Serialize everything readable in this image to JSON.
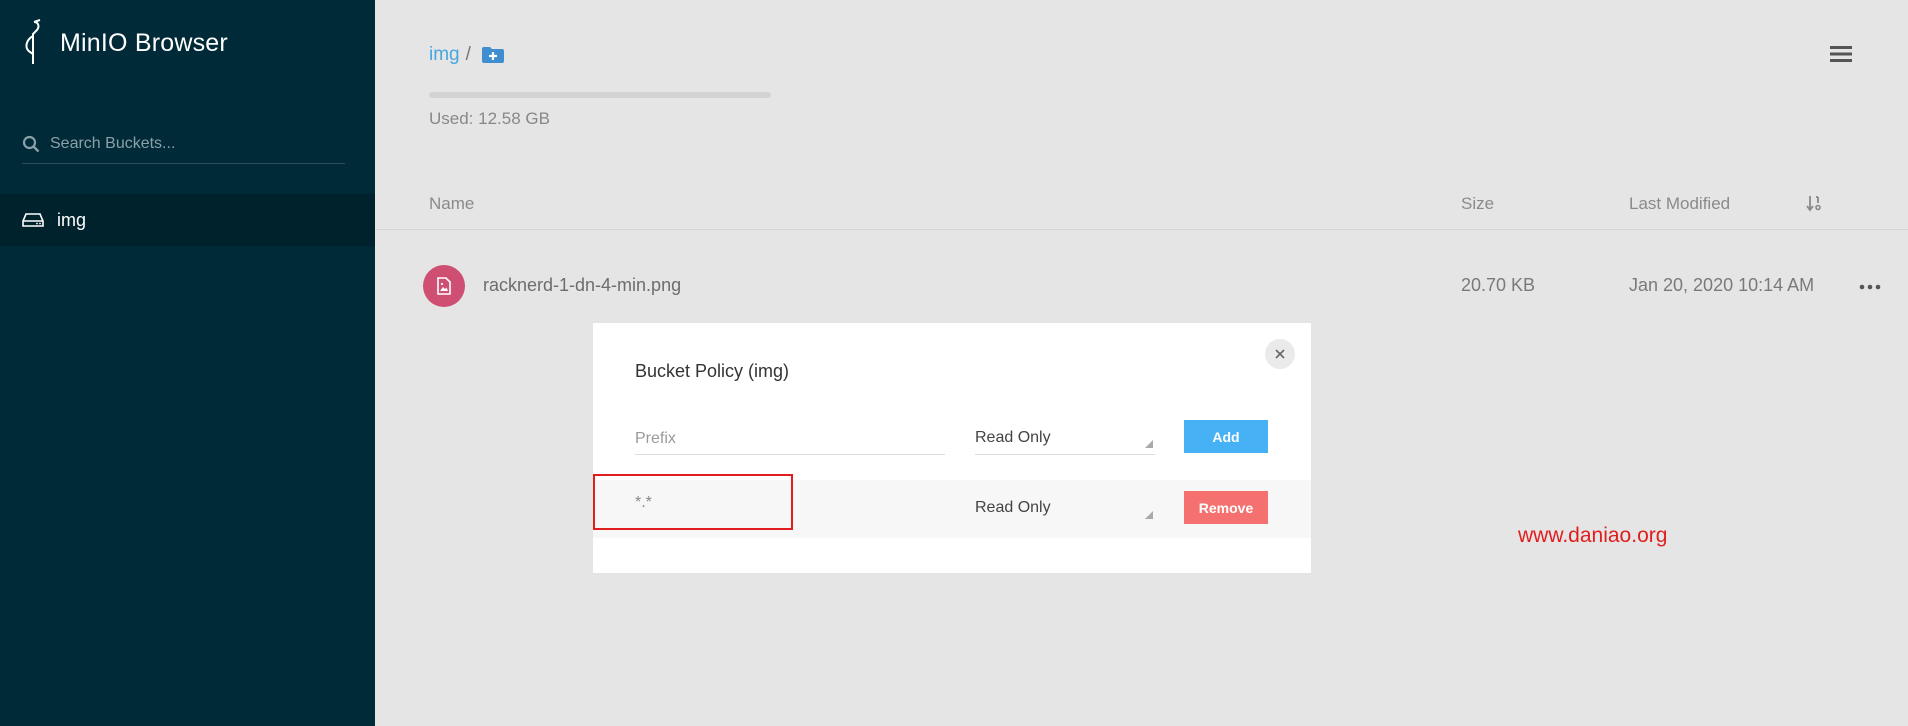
{
  "sidebar": {
    "brand": "MinIO Browser",
    "search_placeholder": "Search Buckets...",
    "buckets": [
      {
        "label": "img",
        "icon": "drive-icon"
      }
    ]
  },
  "header": {
    "breadcrumb_bucket": "img",
    "breadcrumb_sep": "/",
    "usage_text": "Used: 12.58 GB",
    "usage_fraction": 0
  },
  "table": {
    "columns": {
      "name": "Name",
      "size": "Size",
      "modified": "Last Modified"
    },
    "rows": [
      {
        "name": "racknerd-1-dn-4-min.png",
        "size": "20.70 KB",
        "modified": "Jan 20, 2020 10:14 AM",
        "icon": "image-file-icon"
      }
    ]
  },
  "modal": {
    "title": "Bucket Policy (img)",
    "prefix_placeholder": "Prefix",
    "new_policy_value": "Read Only",
    "add_label": "Add",
    "policies": [
      {
        "prefix": "*.*",
        "policy": "Read Only",
        "remove_label": "Remove"
      }
    ]
  },
  "watermark": "www.daniao.org",
  "colors": {
    "sidebar_bg": "#002a37",
    "accent": "#46b1f5",
    "danger": "#f5716f",
    "file_avatar": "#cf4f73",
    "highlight": "#e01e1e"
  }
}
